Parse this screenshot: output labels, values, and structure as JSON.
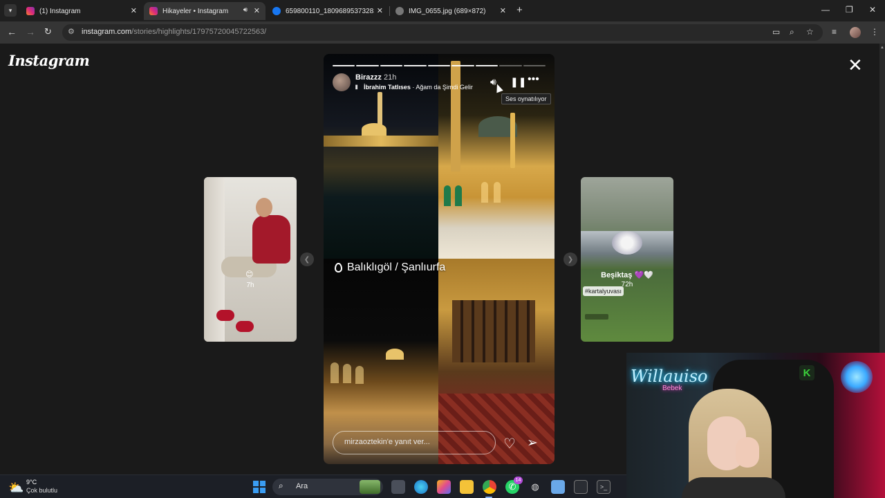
{
  "browser": {
    "tabs": [
      {
        "title": "(1) Instagram",
        "favicon": "instagram-icon",
        "active": false
      },
      {
        "title": "Hikayeler • Instagram",
        "favicon": "instagram-icon",
        "active": true,
        "playing_audio": true
      },
      {
        "title": "659800110_180968953732838...",
        "favicon": "facebook-icon",
        "active": false
      },
      {
        "title": "IMG_0655.jpg (689×872)",
        "favicon": "globe-icon",
        "active": false
      }
    ],
    "url_host": "instagram.com",
    "url_path": "/stories/highlights/17975720045722563/"
  },
  "page": {
    "logo": "Instagram",
    "prev_story": {
      "time": "7h",
      "emoji": "😊"
    },
    "next_story": {
      "username": "Beşiktaş",
      "emoji_suffix": "💜🤍",
      "time": "72h",
      "tag": "#kartalyuvası"
    },
    "story": {
      "progress_total": 9,
      "progress_done": 7,
      "username": "Birazzz",
      "time": "21h",
      "music_artist": "İbrahim Tatlıses",
      "music_title": "Ağam da Şimdi Gelir",
      "music_separator": " · ",
      "tooltip": "Ses oynatılıyor",
      "location": "Balıklıgöl / Şanlıurfa",
      "reply_placeholder": "mirzaoztekin'e yanıt ver..."
    }
  },
  "webcam": {
    "neon_sign": "Willauiso",
    "neon_sub": "Bebek"
  },
  "taskbar": {
    "temperature": "9°C",
    "condition": "Çok bulutlu",
    "search_label": "Ara",
    "whatsapp_badge": "14"
  },
  "colors": {
    "page_bg": "#1a1a1a",
    "accent_blue": "#8ab4f8",
    "instagram_pink": "#e1306c"
  }
}
